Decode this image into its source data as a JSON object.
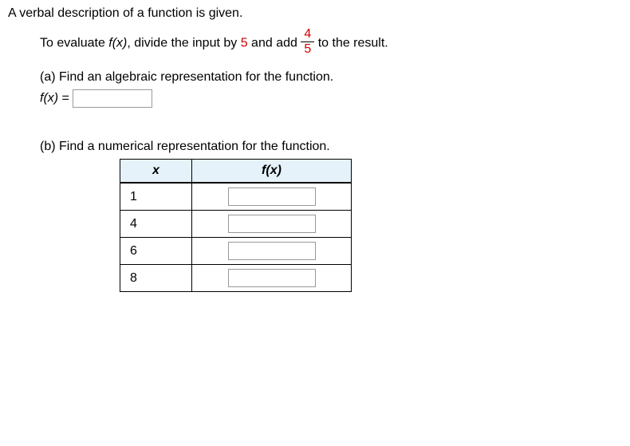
{
  "intro": "A verbal description of a function is given.",
  "sentence": {
    "p1": "To evaluate ",
    "fx": "f(x)",
    "p2": ", divide the input by ",
    "divisor": "5",
    "p3": " and add ",
    "frac_num": "4",
    "frac_den": "5",
    "p4": " to the result."
  },
  "part_a": {
    "label": "(a) Find an algebraic representation for the function.",
    "lhs_fx": "f(x)",
    "eq": " = "
  },
  "part_b": {
    "label": "(b) Find a numerical representation for the function.",
    "header_x": "x",
    "header_fx": "f(x)",
    "rows": [
      {
        "x": "1"
      },
      {
        "x": "4"
      },
      {
        "x": "6"
      },
      {
        "x": "8"
      }
    ]
  }
}
